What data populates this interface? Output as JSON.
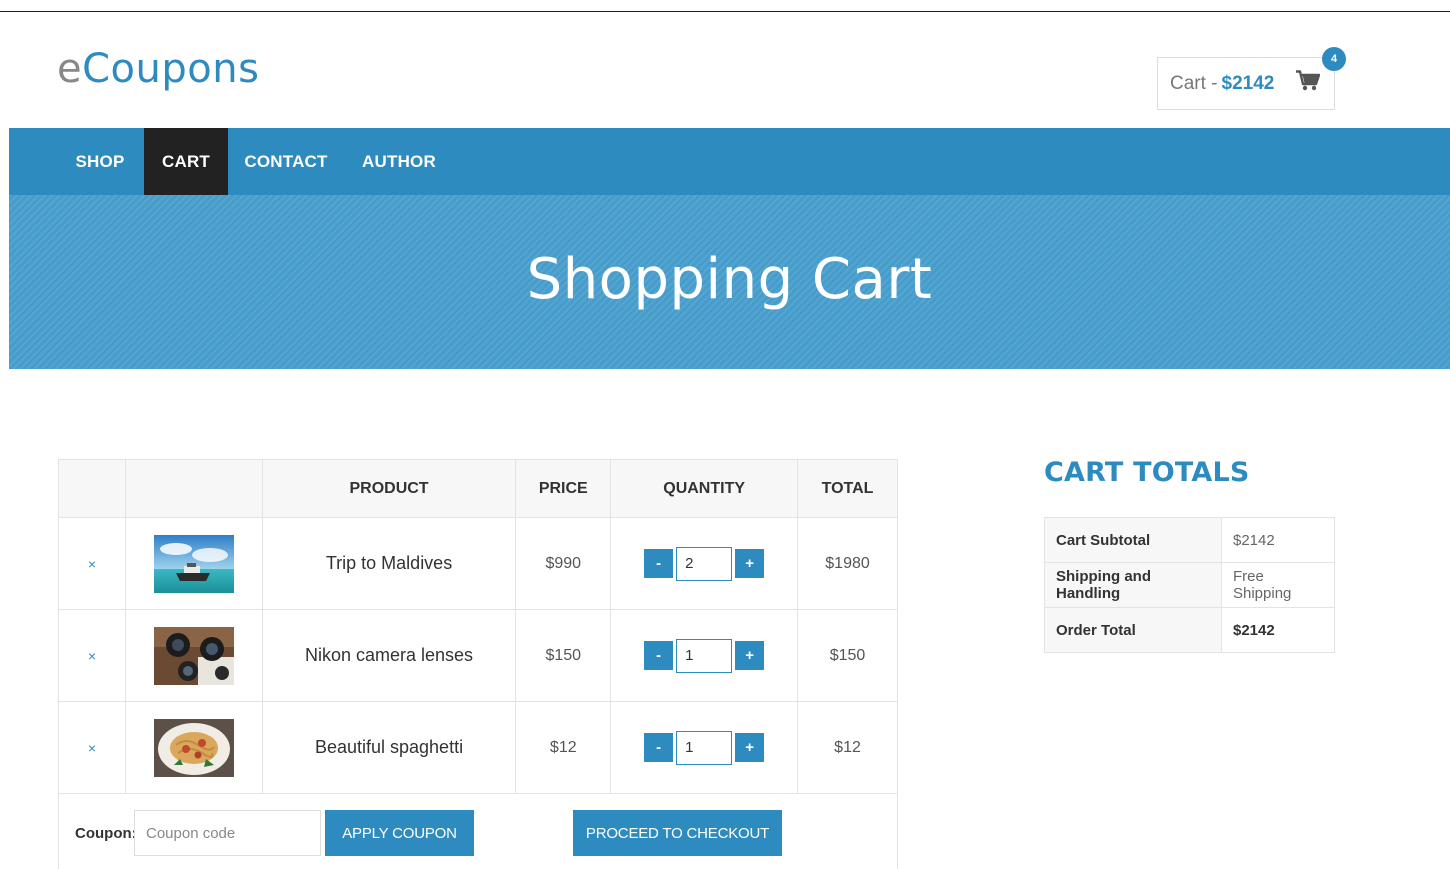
{
  "header": {
    "logo_prefix": "e",
    "logo_rest": "Coupons",
    "cart_label": "Cart -",
    "cart_amount": "$2142",
    "cart_count": "4"
  },
  "nav": {
    "items": [
      {
        "label": "SHOP",
        "active": false
      },
      {
        "label": "CART",
        "active": true
      },
      {
        "label": "CONTACT",
        "active": false
      },
      {
        "label": "AUTHOR",
        "active": false
      }
    ]
  },
  "hero": {
    "title": "Shopping Cart"
  },
  "cart": {
    "headers": {
      "product": "PRODUCT",
      "price": "PRICE",
      "quantity": "QUANTITY",
      "total": "TOTAL"
    },
    "remove_symbol": "×",
    "minus_label": "-",
    "plus_label": "+",
    "items": [
      {
        "name": "Trip to Maldives",
        "price": "$990",
        "qty": "2",
        "total": "$1980",
        "image": "boat-on-sea-photo"
      },
      {
        "name": "Nikon camera lenses",
        "price": "$150",
        "qty": "1",
        "total": "$150",
        "image": "camera-lenses-photo"
      },
      {
        "name": "Beautiful spaghetti",
        "price": "$12",
        "qty": "1",
        "total": "$12",
        "image": "spaghetti-plate-photo"
      }
    ],
    "coupon": {
      "label": "Coupon:",
      "placeholder": "Coupon code",
      "apply_label": "APPLY COUPON"
    },
    "checkout_label": "PROCEED TO CHECKOUT"
  },
  "totals": {
    "heading": "CART TOTALS",
    "rows": [
      {
        "label": "Cart Subtotal",
        "value": "$2142"
      },
      {
        "label": "Shipping and Handling",
        "value": "Free Shipping"
      },
      {
        "label": "Order Total",
        "value": "$2142"
      }
    ]
  },
  "colors": {
    "accent": "#2e8bc0",
    "nav_active": "#222222",
    "hero_bg": "#4aa1cf"
  }
}
